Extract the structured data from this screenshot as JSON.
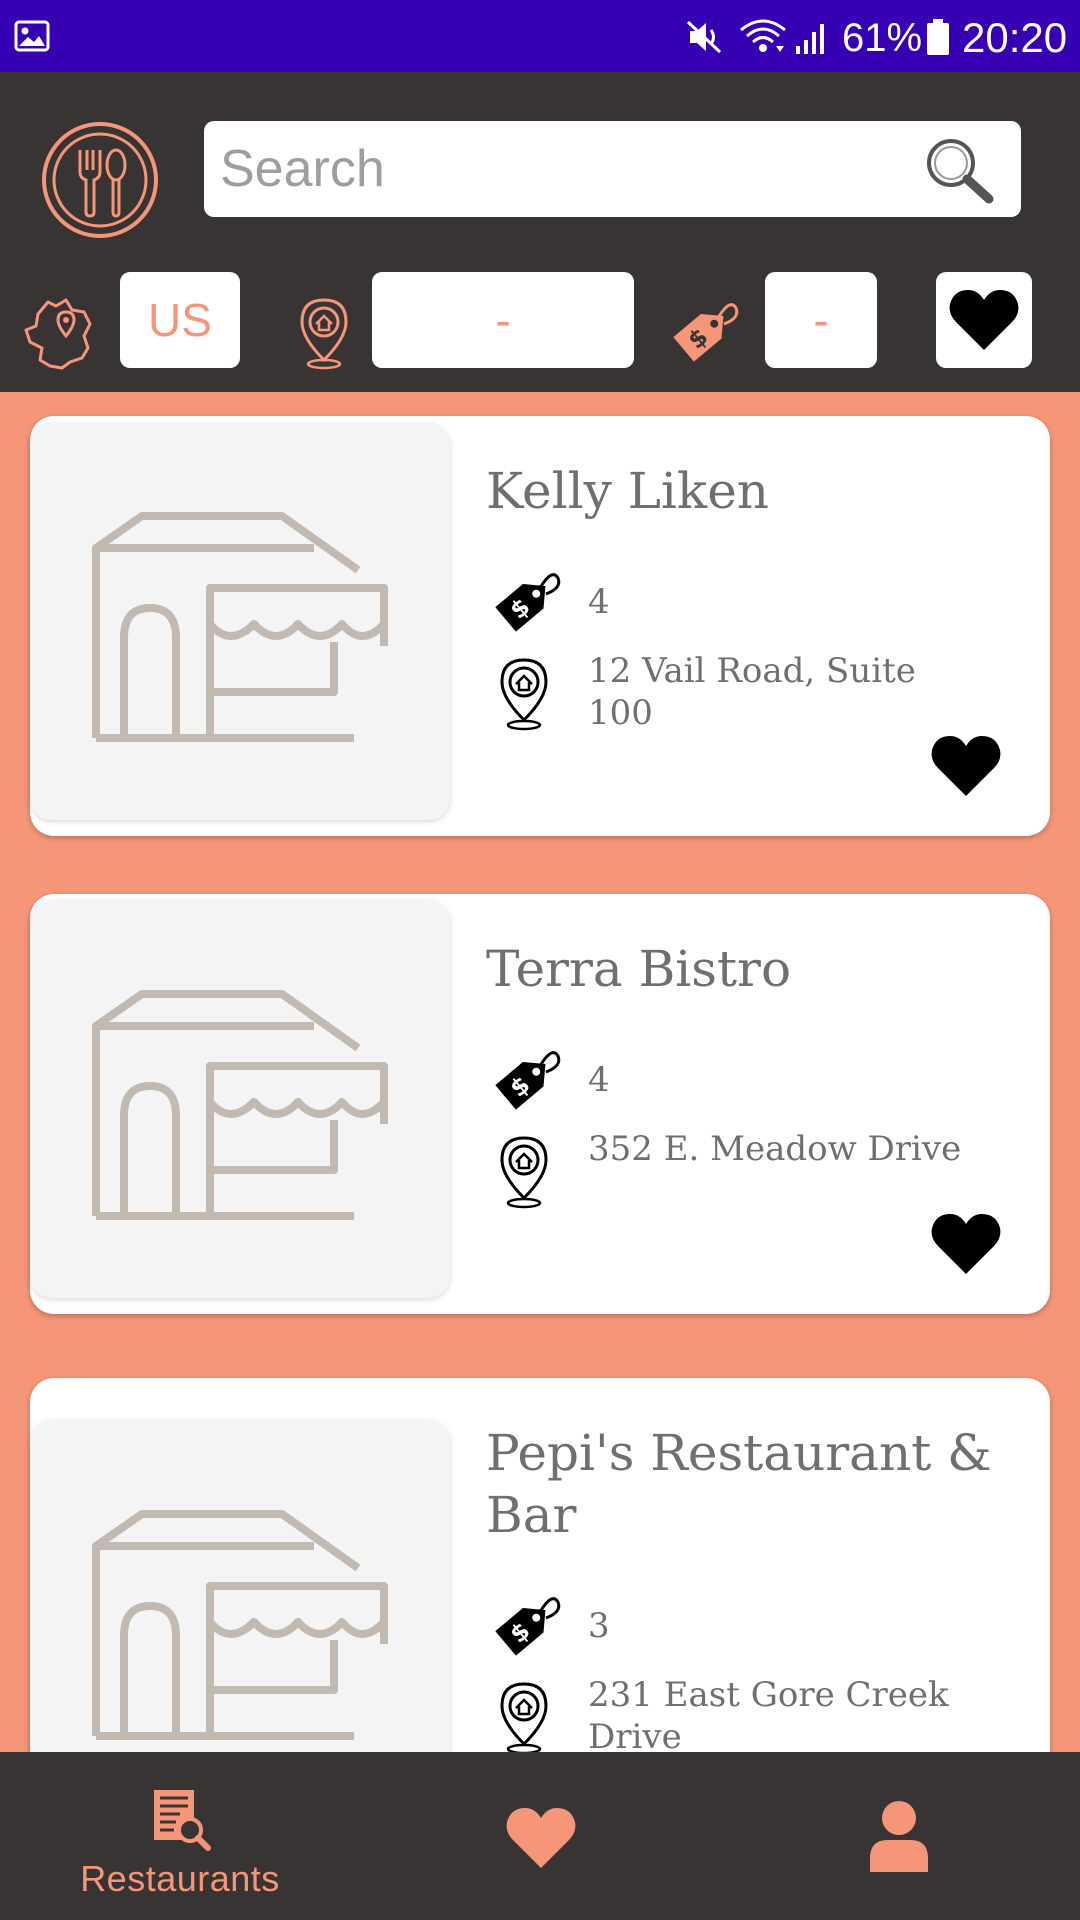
{
  "status_bar": {
    "battery_percent": "61%",
    "time": "20:20",
    "icons": [
      "gallery-icon",
      "mute-icon",
      "wifi-icon",
      "signal-icon",
      "battery-icon"
    ]
  },
  "header": {
    "logo_icon": "fork-spoon-logo-icon",
    "search": {
      "placeholder": "Search",
      "value": ""
    },
    "filters": {
      "country_value": "US",
      "city_value": "-",
      "price_value": "-"
    }
  },
  "colors": {
    "accent": "#f69679",
    "dark": "#383434",
    "status_bar": "#3700b3",
    "card_text": "#6f6f6f"
  },
  "restaurants": [
    {
      "name": "Kelly Liken",
      "price": "4",
      "address": "12 Vail Road, Suite 100"
    },
    {
      "name": "Terra Bistro",
      "price": "4",
      "address": "352 E. Meadow Drive"
    },
    {
      "name": "Pepi's Restaurant & Bar",
      "price": "3",
      "address": "231 East Gore Creek Drive"
    }
  ],
  "bottom_nav": {
    "restaurants_label": "Restaurants",
    "items": [
      "restaurants-list-icon",
      "heart-icon",
      "user-icon"
    ]
  }
}
